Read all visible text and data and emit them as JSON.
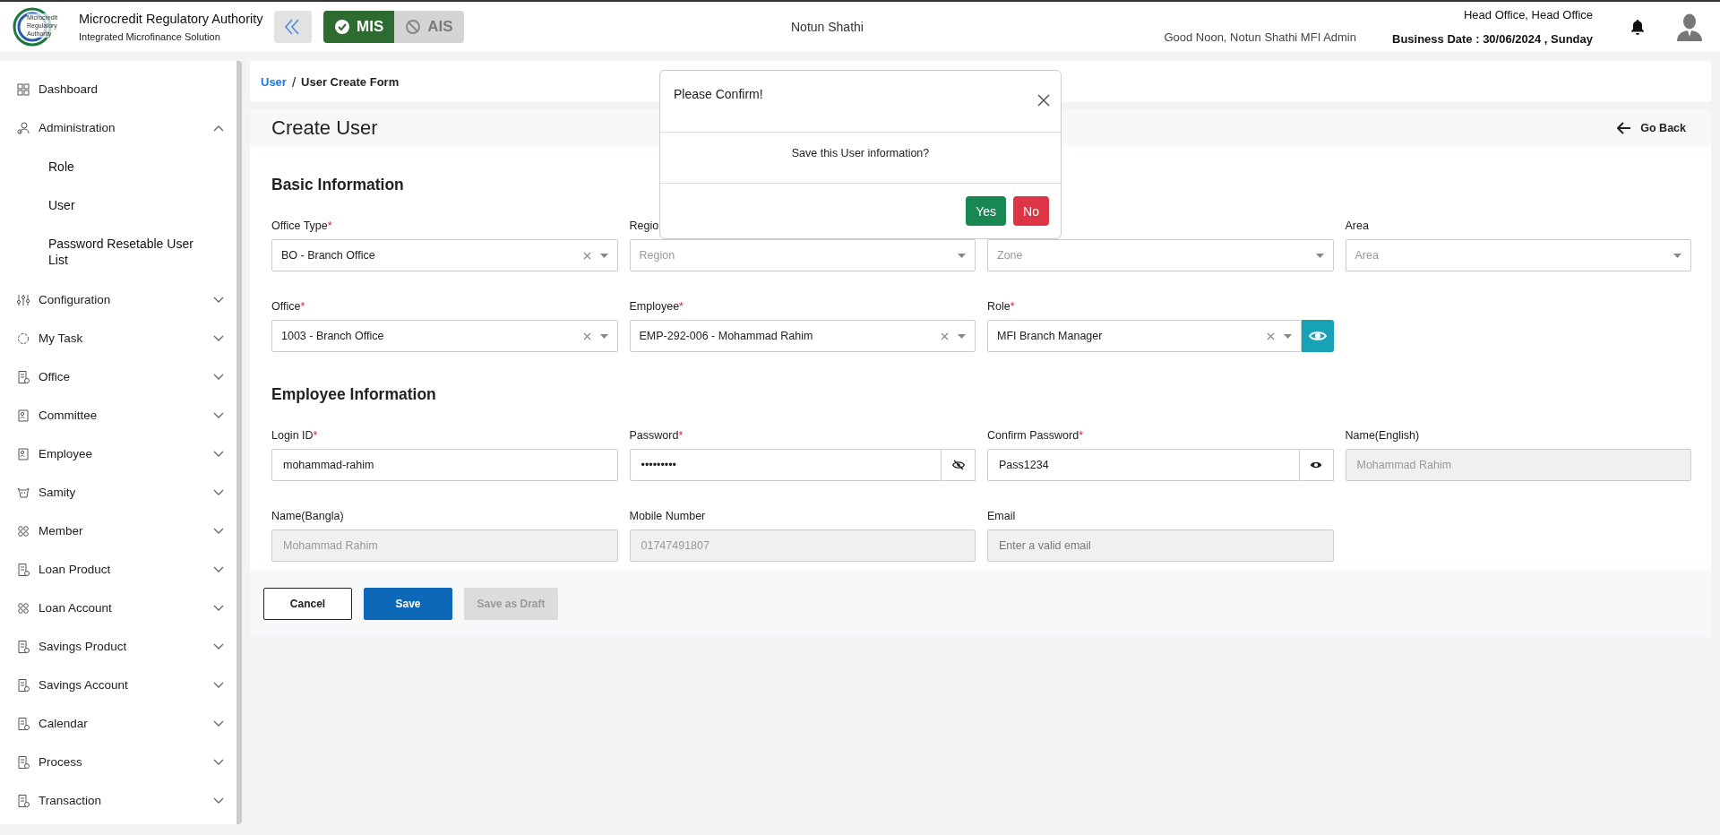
{
  "header": {
    "org_title": "Microcredit Regulatory Authority",
    "org_subtitle": "Integrated Microfinance Solution",
    "logo_text": "Microcredit Regulatory Authority",
    "modules": [
      {
        "label": "MIS",
        "selected": true
      },
      {
        "label": "AIS",
        "selected": false
      }
    ],
    "center_title": "Notun Shathi",
    "greeting": "Good Noon, Notun Shathi MFI Admin",
    "office": "Head Office, Head Office",
    "business_date": "Business Date : 30/06/2024 , Sunday"
  },
  "sidebar": {
    "items": [
      {
        "label": "Dashboard"
      },
      {
        "label": "Administration",
        "expanded": true,
        "children": [
          {
            "label": "Role"
          },
          {
            "label": "User"
          },
          {
            "label": "Password Resetable User List"
          }
        ]
      },
      {
        "label": "Configuration",
        "expanded": false
      },
      {
        "label": "My Task",
        "expanded": false
      },
      {
        "label": "Office",
        "expanded": false
      },
      {
        "label": "Committee",
        "expanded": false
      },
      {
        "label": "Employee",
        "expanded": false
      },
      {
        "label": "Samity",
        "expanded": false
      },
      {
        "label": "Member",
        "expanded": false
      },
      {
        "label": "Loan Product",
        "expanded": false
      },
      {
        "label": "Loan Account",
        "expanded": false
      },
      {
        "label": "Savings Product",
        "expanded": false
      },
      {
        "label": "Savings Account",
        "expanded": false
      },
      {
        "label": "Calendar",
        "expanded": false
      },
      {
        "label": "Process",
        "expanded": false
      },
      {
        "label": "Transaction",
        "expanded": false
      }
    ]
  },
  "breadcrumb": {
    "items": [
      {
        "label": "User",
        "kind": "link"
      },
      {
        "label": "User Create Form",
        "kind": "current"
      }
    ],
    "separator": "/"
  },
  "page": {
    "title": "Create User",
    "go_back": "Go Back"
  },
  "sections": [
    {
      "title": "Basic Information",
      "rows": [
        [
          {
            "label": "Office Type",
            "required_mark": "*",
            "kind": "select",
            "value": "BO - Branch Office",
            "disabled": false
          },
          {
            "label": "Regio",
            "kind": "select",
            "placeholder": "Region",
            "disabled": false
          },
          {
            "kind": "select",
            "placeholder": "Zone",
            "disabled": false
          },
          {
            "label": "Area",
            "kind": "select",
            "placeholder": "Area",
            "disabled": false
          }
        ],
        [
          {
            "label": "Office",
            "required_mark": "*",
            "kind": "select",
            "value": "1003 - Branch Office",
            "disabled": false
          },
          {
            "label": "Employee",
            "required_mark": "*",
            "kind": "select",
            "value": "EMP-292-006 - Mohammad Rahim",
            "disabled": false
          },
          {
            "label": "Role",
            "required_mark": "*",
            "kind": "select_view",
            "value": "MFI Branch Manager",
            "disabled": false
          }
        ]
      ]
    },
    {
      "title": "Employee Information",
      "rows": [
        [
          {
            "label": "Login ID",
            "required_mark": "*",
            "kind": "text",
            "value": "mohammad-rahim",
            "disabled": false
          },
          {
            "label": "Password",
            "required_mark": "*",
            "kind": "password",
            "value": "•••••••••",
            "revealed": false,
            "disabled": false
          },
          {
            "label": "Confirm Password",
            "required_mark": "*",
            "kind": "password",
            "value": "Pass1234",
            "revealed": true,
            "disabled": false
          },
          {
            "label": "Name(English)",
            "kind": "text",
            "value": "Mohammad Rahim",
            "disabled": true
          }
        ],
        [
          {
            "label": "Name(Bangla)",
            "kind": "text",
            "value": "Mohammad Rahim",
            "disabled": true
          },
          {
            "label": "Mobile Number",
            "kind": "text",
            "value": "01747491807",
            "disabled": true
          },
          {
            "label": "Email",
            "kind": "text",
            "placeholder": "Enter a valid email",
            "disabled": true
          }
        ]
      ]
    }
  ],
  "actions": [
    {
      "label": "Cancel",
      "kind": "outline",
      "disabled": false
    },
    {
      "label": "Save",
      "kind": "primary",
      "disabled": false
    },
    {
      "label": "Save as Draft",
      "kind": "primary",
      "disabled": true
    }
  ],
  "dialog": {
    "title": "Please Confirm!",
    "message": "Save this User information?",
    "buttons": [
      {
        "label": "Yes",
        "kind": "confirm"
      },
      {
        "label": "No",
        "kind": "cancel"
      }
    ]
  }
}
